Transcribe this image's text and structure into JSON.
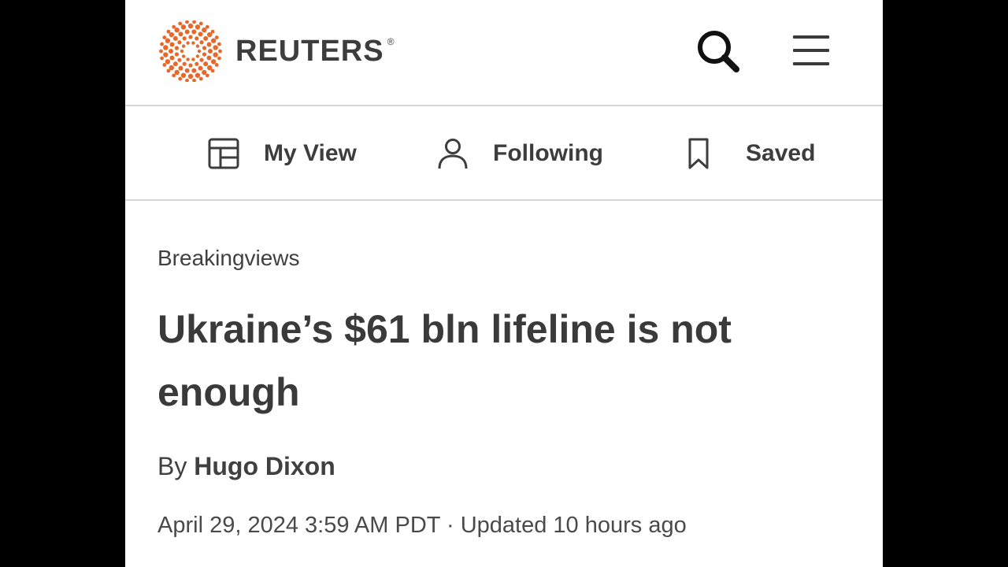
{
  "header": {
    "brand": "REUTERS",
    "registered_mark": "®",
    "icons": {
      "logo": "reuters-dot-logo",
      "search": "search-icon",
      "menu": "hamburger-menu-icon"
    },
    "colors": {
      "logo_orange": "#e6682a",
      "text_dark": "#3d3d3d"
    }
  },
  "nav": {
    "items": [
      {
        "label": "My View",
        "icon": "layout-icon"
      },
      {
        "label": "Following",
        "icon": "person-icon"
      },
      {
        "label": "Saved",
        "icon": "bookmark-icon"
      }
    ]
  },
  "article": {
    "section": "Breakingviews",
    "headline": "Ukraine’s $61 bln lifeline is not enough",
    "byline_prefix": "By",
    "author": "Hugo Dixon",
    "dateline": "April 29, 2024 3:59 AM PDT · Updated 10 hours ago"
  }
}
